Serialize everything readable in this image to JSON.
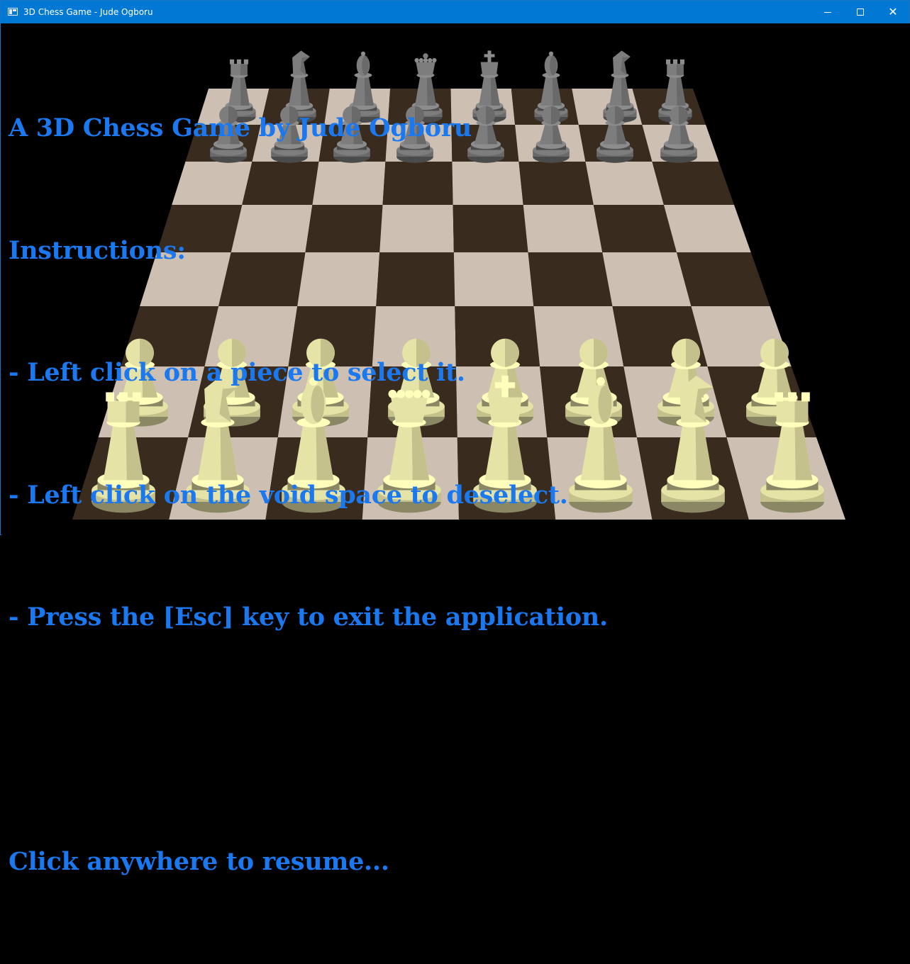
{
  "window": {
    "title": "3D Chess Game - Jude Ogboru",
    "controls": {
      "minimize": "minimize",
      "maximize": "maximize",
      "close": "✕"
    }
  },
  "overlay": {
    "title": "A 3D Chess Game by Jude Ogboru",
    "instructions_heading": "Instructions:",
    "instructions": [
      "- Left click on a piece to select it.",
      "- Left click on the void space to deselect.",
      "- Press the [Esc] key to exit the application."
    ],
    "resume_prompt": "Click anywhere to resume..."
  },
  "board": {
    "squares": 64,
    "light_square_color": "#cdbfb2",
    "dark_square_color": "#392c1e",
    "background_color": "#000000"
  },
  "pieces": {
    "black_color": "#7d7d7d",
    "white_color": "#e6e3a6",
    "black_back_rank": [
      "rook",
      "knight",
      "bishop",
      "queen",
      "king",
      "bishop",
      "knight",
      "rook"
    ],
    "black_pawns": 8,
    "white_pawns": 8,
    "white_back_rank": [
      "rook",
      "knight",
      "bishop",
      "queen",
      "king",
      "bishop",
      "knight",
      "rook"
    ]
  },
  "text_color": "#1a78f0"
}
